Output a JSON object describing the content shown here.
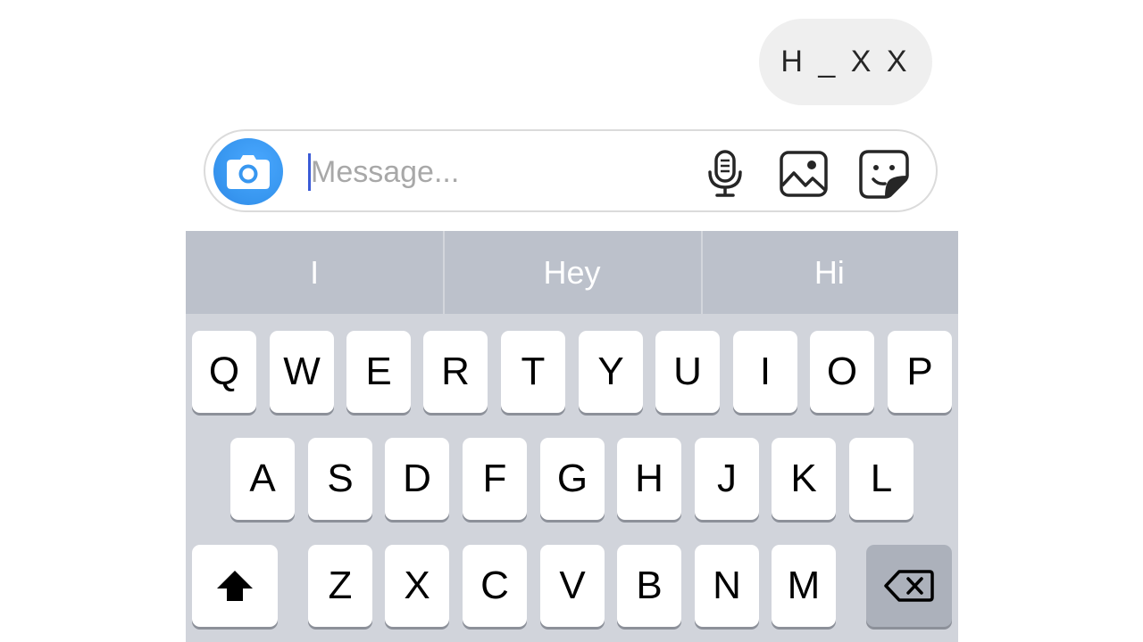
{
  "conversation": {
    "sent_message": "H _ X X"
  },
  "composer": {
    "placeholder": "Message...",
    "value": "",
    "camera_icon": "camera-icon",
    "mic_icon": "microphone-icon",
    "gallery_icon": "gallery-icon",
    "sticker_icon": "sticker-icon"
  },
  "keyboard": {
    "suggestions": [
      "I",
      "Hey",
      "Hi"
    ],
    "row1": [
      "Q",
      "W",
      "E",
      "R",
      "T",
      "Y",
      "U",
      "I",
      "O",
      "P"
    ],
    "row2": [
      "A",
      "S",
      "D",
      "F",
      "G",
      "H",
      "J",
      "K",
      "L"
    ],
    "row3": [
      "Z",
      "X",
      "C",
      "V",
      "B",
      "N",
      "M"
    ],
    "shift_icon": "shift-arrow-icon",
    "delete_icon": "backspace-icon"
  },
  "colors": {
    "accent": "#3897f0",
    "bubble": "#efefef",
    "keyboard_bg": "#d1d4db",
    "suggestion_bar": "#bcc1cb",
    "caret": "#3b5bd6"
  }
}
